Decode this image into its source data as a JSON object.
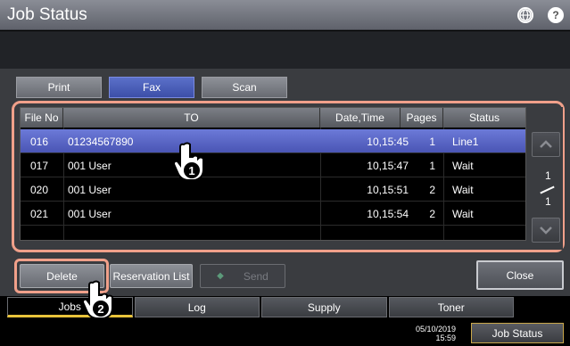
{
  "header": {
    "title": "Job Status",
    "globe_icon": "globe-icon",
    "help_icon": "help-icon",
    "help_glyph": "?"
  },
  "top_tabs": [
    {
      "label": "Print"
    },
    {
      "label": "Fax"
    },
    {
      "label": "Scan"
    }
  ],
  "table": {
    "columns": [
      "File No",
      "TO",
      "Date,Time",
      "Pages",
      "Status"
    ],
    "rows": [
      {
        "file_no": "016",
        "to": "01234567890",
        "datetime": "10,15:45",
        "pages": "1",
        "status": "Line1",
        "selected": true
      },
      {
        "file_no": "017",
        "to": "001 User",
        "datetime": "10,15:47",
        "pages": "1",
        "status": "Wait"
      },
      {
        "file_no": "020",
        "to": "001 User",
        "datetime": "10,15:51",
        "pages": "2",
        "status": "Wait"
      },
      {
        "file_no": "021",
        "to": "001 User",
        "datetime": "10,15:54",
        "pages": "2",
        "status": "Wait"
      }
    ]
  },
  "pager": {
    "current": "1",
    "total": "1",
    "up_icon": "chevron-up-icon",
    "down_icon": "chevron-down-icon"
  },
  "actions": {
    "delete": "Delete",
    "reservation_list": "Reservation List",
    "send": "Send",
    "close": "Close"
  },
  "bottom_tabs": [
    {
      "label": "Jobs"
    },
    {
      "label": "Log"
    },
    {
      "label": "Supply"
    },
    {
      "label": "Toner"
    }
  ],
  "status_bar": {
    "date": "05/10/2019",
    "time": "15:59",
    "job_status": "Job Status"
  },
  "callouts": {
    "step1": "1",
    "step2": "2"
  },
  "colors": {
    "accent": "#4a55b4",
    "highlight_frame": "#f0a08a",
    "active_tab_underline": "#e8c33a"
  }
}
